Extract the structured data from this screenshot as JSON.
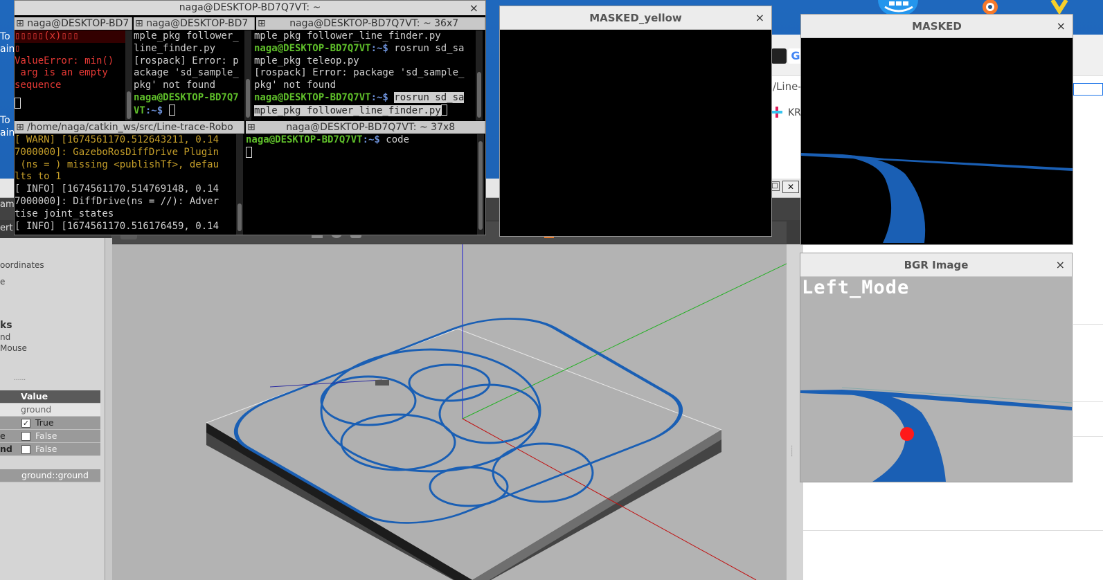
{
  "desktop": {
    "left_labels": [
      "To",
      "ain",
      "To",
      "ain"
    ]
  },
  "browser": {
    "path_text": "/Line-",
    "bookmark_text": "KR"
  },
  "terminal": {
    "window_title": "naga@DESKTOP-BD7Q7VT: ~",
    "close": "×",
    "top_tabs": [
      "naga@DESKTOP-BD7",
      "naga@DESKTOP-BD7",
      "naga@DESKTOP-BD7Q7VT: ~ 36x7"
    ],
    "pane1_lines": [
      "ValueError: min()",
      " arg is an empty",
      "sequence"
    ],
    "pane1_garbled": "▯▯▯▯▯(x)▯▯▯",
    "pane2_lines": [
      "mple_pkg follower_",
      "line_finder.py",
      "[rospack] Error: p",
      "ackage 'sd_sample_",
      "pkg' not found"
    ],
    "pane2_prompt_user": "naga@DESKTOP-BD7Q7",
    "pane2_prompt_rest": "VT",
    "pane2_prompt_end": ":~$ ",
    "pane3_lines": [
      "mple_pkg follower_line_finder.py"
    ],
    "pane3_prompt_user": "naga@DESKTOP-BD7Q7VT",
    "pane3_prompt_end": ":~$ ",
    "pane3_cmd1a": "rosrun sd_sa",
    "pane3_cmd1b": "mple_pkg teleop.py",
    "pane3_err": [
      "[rospack] Error: package 'sd_sample_",
      "pkg' not found"
    ],
    "pane3_cmd2a": "rosrun sd_sa",
    "pane3_cmd2b": "mple_pkg follower_line_finder.py",
    "bottom_tabs": [
      "/home/naga/catkin_ws/src/Line-trace-Robo",
      "naga@DESKTOP-BD7Q7VT: ~ 37x8"
    ],
    "pane4_lines": [
      {
        "text": "[ WARN] [1674561170.512643211, 0.14",
        "c": "yel"
      },
      {
        "text": "7000000]: GazeboRosDiffDrive Plugin",
        "c": "yel"
      },
      {
        "text": " (ns = ) missing <publishTf>, defau",
        "c": "yel"
      },
      {
        "text": "lts to 1",
        "c": "yel"
      },
      {
        "text": "[ INFO] [1674561170.514769148, 0.14",
        "c": "white"
      },
      {
        "text": "7000000]: DiffDrive(ns = //): Adver",
        "c": "white"
      },
      {
        "text": "tise joint_states",
        "c": "white"
      },
      {
        "text": "[ INFO] [1674561170.516176459, 0.14",
        "c": "white"
      }
    ],
    "pane5_prompt_user": "naga@DESKTOP-BD7Q7VT",
    "pane5_prompt_end": ":~$ ",
    "pane5_cmd": "code"
  },
  "masked_yellow": {
    "title": "MASKED_yellow",
    "close": "×"
  },
  "masked": {
    "title": "MASKED",
    "close": "×"
  },
  "bgr": {
    "title": "BGR Image",
    "close": "×",
    "overlay_text": "Left_Mode"
  },
  "gazebo": {
    "left_labels": [
      "ame",
      "ert",
      "oordinates",
      "e",
      "ks",
      "nd",
      "Mouse"
    ],
    "prop_header": "Value",
    "props": [
      {
        "label": "",
        "value": "ground",
        "check": null
      },
      {
        "label": "",
        "value": "True",
        "check": true
      },
      {
        "label": "e",
        "value": "False",
        "check": false
      },
      {
        "label": "nd",
        "value": "False",
        "check": false
      }
    ],
    "prop_footer": "ground::ground",
    "title_btns": [
      "□",
      "✕"
    ],
    "grip": "......"
  },
  "colors": {
    "track_blue": "#1a5fb4",
    "prompt_green": "#5fbf2a",
    "error_red": "#e53935",
    "warn_yellow": "#c7a02a"
  }
}
